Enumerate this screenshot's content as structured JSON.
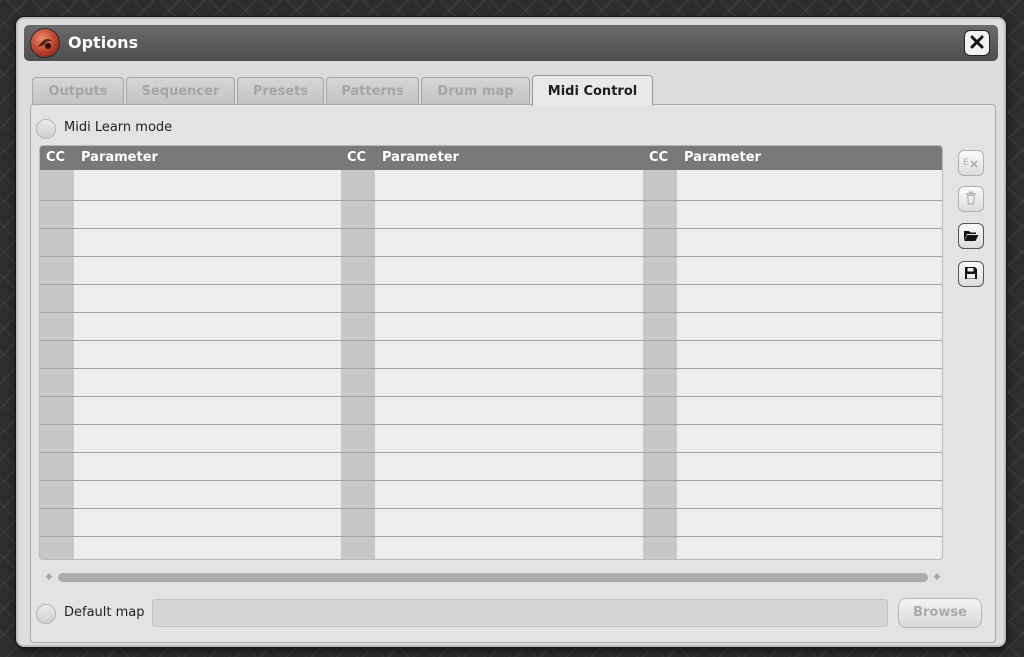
{
  "window": {
    "title": "Options",
    "icons": {
      "app": "app-logo-icon",
      "close": "close-icon"
    }
  },
  "tabs": [
    {
      "label": "Outputs",
      "active": false
    },
    {
      "label": "Sequencer",
      "active": false
    },
    {
      "label": "Presets",
      "active": false
    },
    {
      "label": "Patterns",
      "active": false
    },
    {
      "label": "Drum map",
      "active": false
    },
    {
      "label": "Midi Control",
      "active": true
    }
  ],
  "midi_learn": {
    "label": "Midi Learn mode",
    "checked": false
  },
  "table": {
    "columns": [
      {
        "cc": "CC",
        "parameter": "Parameter"
      },
      {
        "cc": "CC",
        "parameter": "Parameter"
      },
      {
        "cc": "CC",
        "parameter": "Parameter"
      }
    ],
    "rows": []
  },
  "side_buttons": [
    {
      "icon": "clear-icon",
      "enabled": false
    },
    {
      "icon": "trash-icon",
      "enabled": false
    },
    {
      "icon": "open-folder-icon",
      "enabled": true
    },
    {
      "icon": "save-icon",
      "enabled": true
    }
  ],
  "default_map": {
    "label": "Default map",
    "checked": false,
    "value": ""
  },
  "browse": {
    "label": "Browse",
    "enabled": false
  },
  "colors": {
    "titlebar": "#5a5a5a",
    "table_header": "#797979",
    "active_tab_text": "#1f1f1f",
    "disabled_text": "#a5a5a5"
  }
}
